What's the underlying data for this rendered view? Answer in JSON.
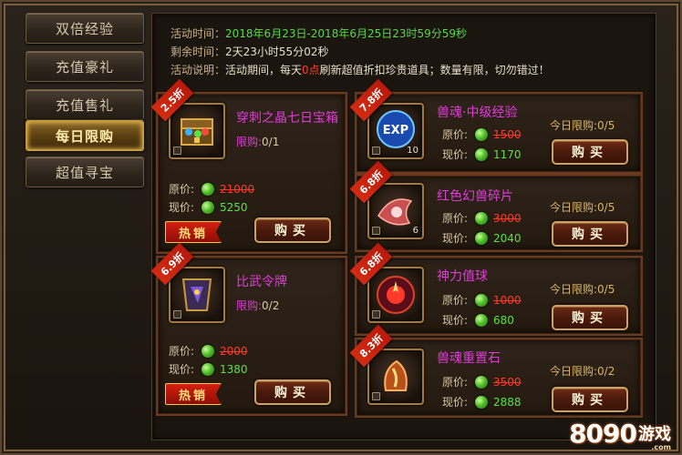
{
  "sidebar": {
    "items": [
      {
        "label": "双倍经验",
        "active": false
      },
      {
        "label": "充值豪礼",
        "active": false
      },
      {
        "label": "充值售礼",
        "active": false
      },
      {
        "label": "每日限购",
        "active": true
      },
      {
        "label": "超值寻宝",
        "active": false
      }
    ]
  },
  "info": {
    "time_label": "活动时间：",
    "time_value": "2018年6月23日-2018年6月25日23时59分59秒",
    "remain_label": "剩余时间：",
    "remain_value": "2天23小时55分02秒",
    "desc_label": "活动说明：",
    "desc_prefix": "活动期间，每天",
    "desc_highlight": "0点",
    "desc_suffix": "刷新超值折扣珍贵道具；数量有限，切勿错过！"
  },
  "labels": {
    "orig_price": "原价:",
    "cur_price": "现价:",
    "limit": "限购:",
    "today_limit": "今日限购:",
    "buy": "购买",
    "hot": "热销"
  },
  "items": [
    {
      "name": "穿刺之晶七日宝箱",
      "discount": "2.5折",
      "limit": "0/1",
      "orig": "21000",
      "cur": "5250",
      "hot": true,
      "name_color": "#e03bd8",
      "icon": "treasure-chest-icon"
    },
    {
      "name": "比武令牌",
      "discount": "6.9折",
      "limit": "0/2",
      "orig": "2000",
      "cur": "1380",
      "hot": true,
      "name_color": "#e03bd8",
      "icon": "token-icon"
    },
    {
      "name": "兽魂·中级经验",
      "discount": "7.8折",
      "limit": "0/5",
      "orig": "1500",
      "cur": "1170",
      "qty": "10",
      "name_color": "#e03bd8",
      "icon": "exp-orb-icon"
    },
    {
      "name": "红色幻兽碎片",
      "discount": "6.8折",
      "limit": "0/5",
      "orig": "3000",
      "cur": "2040",
      "qty": "6",
      "name_color": "#e03bd8",
      "icon": "beast-shard-icon"
    },
    {
      "name": "神力值球",
      "discount": "6.8折",
      "limit": "0/5",
      "orig": "1000",
      "cur": "680",
      "name_color": "#e03bd8",
      "icon": "power-orb-icon"
    },
    {
      "name": "兽魂重置石",
      "discount": "8.3折",
      "limit": "0/2",
      "orig": "3500",
      "cur": "2888",
      "name_color": "#e03bd8",
      "icon": "reset-stone-icon"
    }
  ],
  "logo": {
    "num": "8090",
    "text": "游戏",
    "sub": ".com"
  },
  "colors": {
    "accent": "#c79a3b",
    "price_new": "#5be04a",
    "price_old": "#ff3a2a",
    "name": "#e03bd8"
  }
}
